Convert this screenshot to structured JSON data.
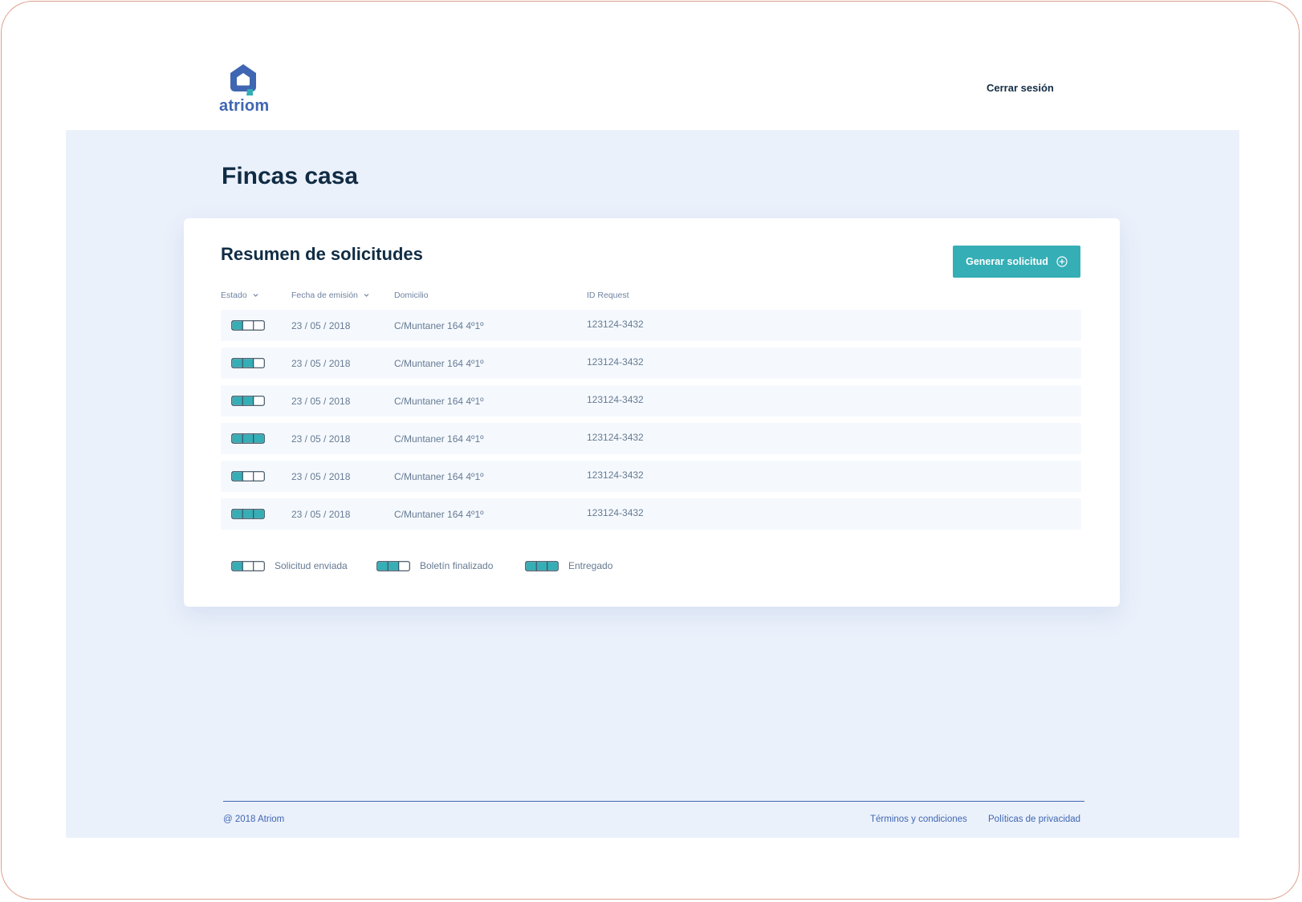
{
  "header": {
    "logo_text": "atriom",
    "logout_label": "Cerrar sesión"
  },
  "page": {
    "title": "Fincas casa"
  },
  "card": {
    "title": "Resumen de solicitudes",
    "generate_button_label": "Generar solicitud",
    "generate_button_icon": "plus-circle-icon"
  },
  "table": {
    "columns": [
      {
        "label": "Estado",
        "sortable": true
      },
      {
        "label": "Fecha de emisión",
        "sortable": true
      },
      {
        "label": "Domicilio",
        "sortable": false
      },
      {
        "label": "ID Request",
        "sortable": false
      }
    ],
    "rows": [
      {
        "status_steps": 1,
        "date": "23 / 05 / 2018",
        "address": "C/Muntaner 164 4º1º",
        "id": "123124-3432"
      },
      {
        "status_steps": 2,
        "date": "23 / 05 / 2018",
        "address": "C/Muntaner 164 4º1º",
        "id": "123124-3432"
      },
      {
        "status_steps": 2,
        "date": "23 / 05 / 2018",
        "address": "C/Muntaner 164 4º1º",
        "id": "123124-3432"
      },
      {
        "status_steps": 3,
        "date": "23 / 05 / 2018",
        "address": "C/Muntaner 164 4º1º",
        "id": "123124-3432"
      },
      {
        "status_steps": 1,
        "date": "23 / 05 / 2018",
        "address": "C/Muntaner 164 4º1º",
        "id": "123124-3432"
      },
      {
        "status_steps": 3,
        "date": "23 / 05 / 2018",
        "address": "C/Muntaner 164 4º1º",
        "id": "123124-3432"
      }
    ]
  },
  "legend": [
    {
      "label": "Solicitud enviada",
      "status_steps": 1
    },
    {
      "label": "Boletín finalizado",
      "status_steps": 2
    },
    {
      "label": "Entregado",
      "status_steps": 3
    }
  ],
  "footer": {
    "copyright": "@ 2018 Atriom",
    "terms_label": "Términos y condiciones",
    "privacy_label": "Políticas de privacidad"
  },
  "colors": {
    "accent": "#35aeb6",
    "brand": "#3f66b2",
    "background": "#ebf1fb",
    "text_dark": "#102c44"
  }
}
